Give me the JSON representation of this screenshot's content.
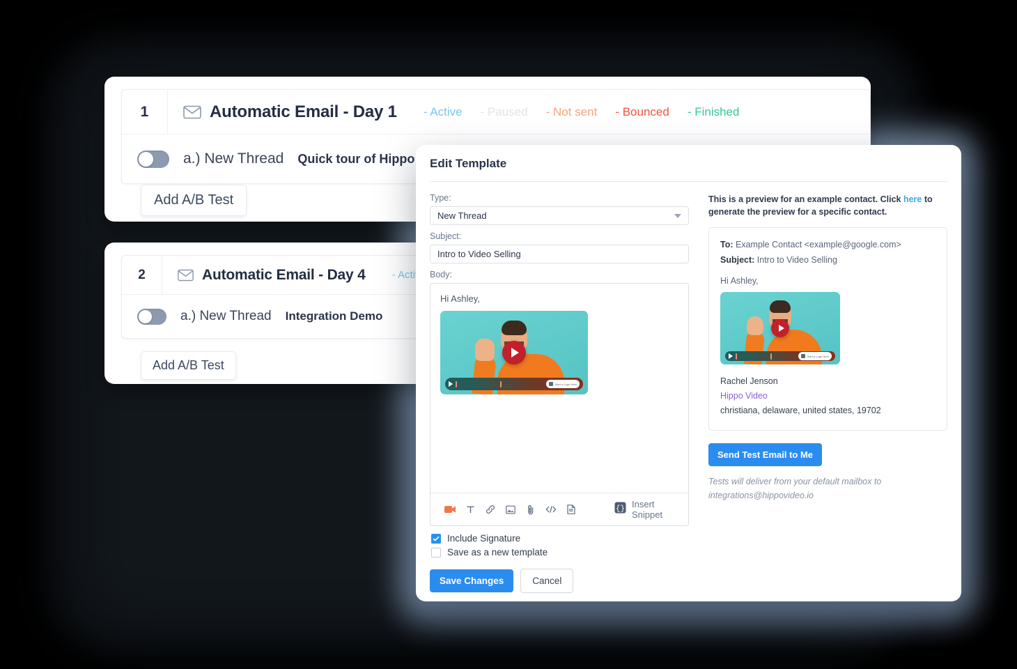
{
  "background_color": "#000000",
  "accent_blue": "#2b8cf0",
  "sequence_cards": [
    {
      "number": "1",
      "icon": "mail-icon",
      "title": "Automatic Email - Day 1",
      "statuses": [
        {
          "label": "- Active",
          "color": "#7ec4ef"
        },
        {
          "label": "- Paused",
          "color": "#dfe3e8"
        },
        {
          "label": "- Not sent",
          "color": "#f7a47a"
        },
        {
          "label": "- Bounced",
          "color": "#f4543c"
        },
        {
          "label": "- Finished",
          "color": "#37c79a"
        }
      ],
      "toggle_on": false,
      "thread_label": "a.) New Thread",
      "thread_subject": "Quick tour of Hippo Video",
      "ab_button": "Add A/B Test"
    },
    {
      "number": "2",
      "icon": "mail-icon",
      "title": "Automatic Email - Day 4",
      "statuses": [
        {
          "label": "- Active",
          "color": "#7ec4ef"
        }
      ],
      "toggle_on": false,
      "thread_label": "a.) New Thread",
      "thread_subject": "Integration Demo",
      "ab_button": "Add A/B Test"
    }
  ],
  "modal": {
    "title": "Edit Template",
    "type_label": "Type:",
    "type_value": "New Thread",
    "subject_label": "Subject:",
    "subject_value": "Intro to Video Selling",
    "body_label": "Body:",
    "body_greeting": "Hi Ashley,",
    "toolbar_icons": [
      "video-camera-icon",
      "text-format-icon",
      "link-icon",
      "image-icon",
      "attachment-icon",
      "code-icon",
      "document-icon"
    ],
    "snippet_icon": "curly-braces-icon",
    "snippet_label": "Insert Snippet",
    "checkboxes": [
      {
        "label": "Include Signature",
        "checked": true
      },
      {
        "label": "Save as a new template",
        "checked": false
      }
    ],
    "save_label": "Save Changes",
    "cancel_label": "Cancel"
  },
  "preview": {
    "note_before": "This is a preview for an example contact. Click ",
    "note_link": "here",
    "note_after": " to generate the preview for a specific contact.",
    "to_label": "To:",
    "to_value": " Example Contact <example@google.com>",
    "subject_label": "Subject:",
    "subject_value": " Intro to Video Selling",
    "greeting": "Hi Ashley,",
    "signature_name": "Rachel Jenson",
    "signature_brand": "Hippo Video",
    "signature_address": "christiana, delaware, united states, 19702",
    "send_button": "Send Test Email to Me",
    "send_note_line1": "Tests will deliver from your default mailbox to",
    "send_note_line2": "integrations@hippovideo.io"
  },
  "video_thumbnail": {
    "chip_label": "Start a Logo Here",
    "play_icon": "play-button-icon"
  }
}
